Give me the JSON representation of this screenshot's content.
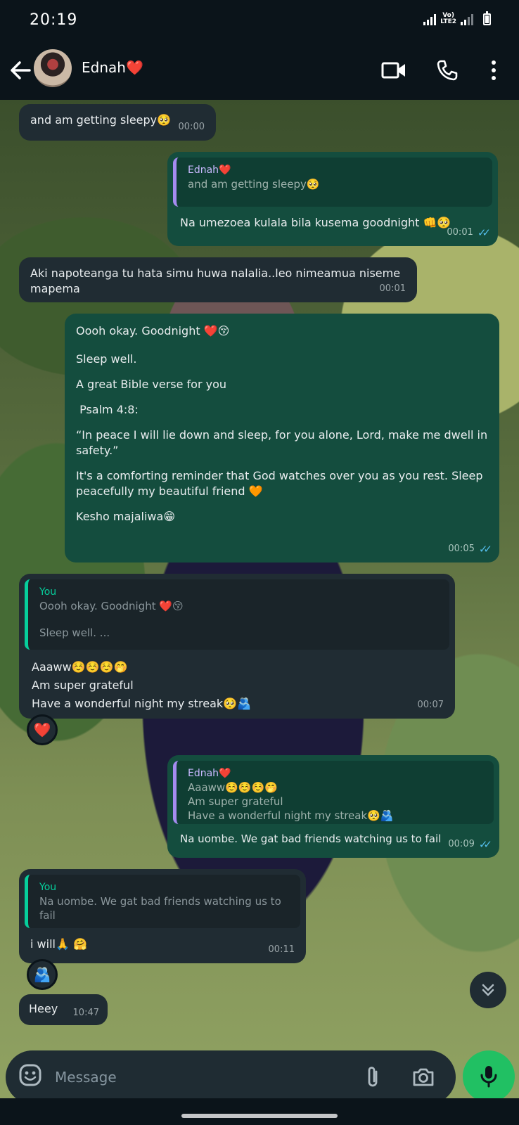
{
  "status_bar": {
    "time": "20:19",
    "network_line1": "Vo)",
    "network_line2": "LTE2"
  },
  "header": {
    "contact_name": "Ednah❤️"
  },
  "messages": [
    {
      "text": "and am getting sleepy🥺",
      "time": "00:00"
    },
    {
      "quote_author": "Ednah❤️",
      "quote_text": "and am getting sleepy🥺",
      "text": "Na umezoea kulala bila kusema goodnight 👊🥺",
      "time": "00:01"
    },
    {
      "text": "Aki napoteanga tu hata simu huwa nalalia..leo nimeamua niseme mapema",
      "time": "00:01"
    },
    {
      "paragraphs": [
        "Oooh okay. Goodnight ❤️😚",
        "Sleep well.",
        "A great Bible verse for you",
        " Psalm 4:8:",
        "“In peace I will lie down and sleep, for you alone, Lord, make me dwell in safety.”",
        "It's a comforting reminder that God watches over you as you rest. Sleep peacefully my beautiful friend 🧡",
        "Kesho majaliwa😁"
      ],
      "time": "00:05"
    },
    {
      "quote_author": "You",
      "quote_line1": "Oooh okay. Goodnight ❤️😚",
      "quote_line2": "Sleep well. ...",
      "line1": "Aaaww☺️☺️☺️🤭",
      "line2": "Am super grateful",
      "line3": "Have a wonderful night my streak🥺🫂",
      "time": "00:07",
      "reaction": "❤️"
    },
    {
      "quote_author": "Ednah❤️",
      "quote_line1": "Aaaww☺️☺️☺️🤭",
      "quote_line2": "Am super grateful",
      "quote_line3": "Have a wonderful night my streak🥺🫂",
      "text": "Na uombe. We gat bad friends watching us to fail",
      "time": "00:09"
    },
    {
      "quote_author": "You",
      "quote_text": "Na uombe. We gat bad friends watching us to fail",
      "text": "i will🙏 🤗",
      "time": "00:11",
      "reaction": "🫂"
    },
    {
      "text": "Heey",
      "time": "10:47"
    }
  ],
  "composer": {
    "placeholder": "Message"
  },
  "icons": {
    "back": "back-arrow-icon",
    "video": "video-call-icon",
    "call": "phone-icon",
    "menu": "more-vertical-icon",
    "emoji": "emoji-icon",
    "attach": "paperclip-icon",
    "camera": "camera-icon",
    "mic": "microphone-icon",
    "scroll": "double-chevron-down-icon"
  },
  "colors": {
    "accent_green": "#21c063",
    "outgoing_bubble": "#144d3e",
    "incoming_bubble": "#202c33",
    "read_tick": "#53bdeb"
  }
}
